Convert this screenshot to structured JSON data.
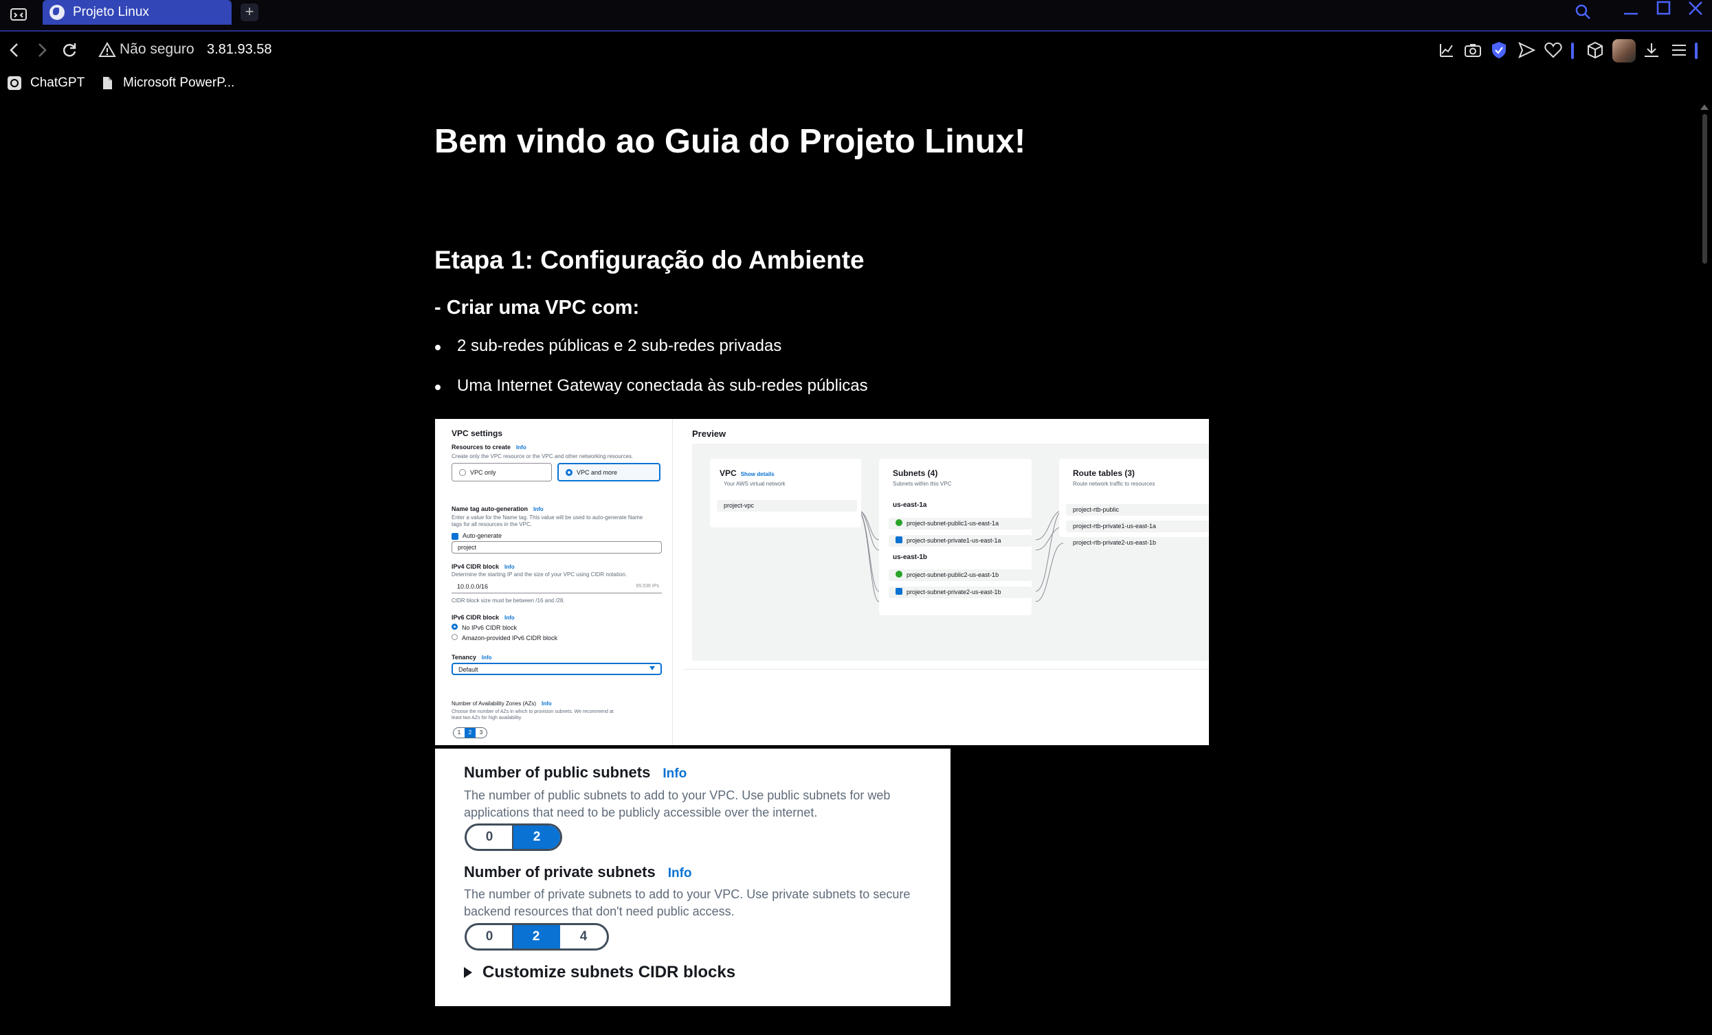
{
  "browser": {
    "tab_title": "Projeto Linux",
    "new_tab": "+",
    "security_label": "Não seguro",
    "url": "3.81.93.58",
    "bookmarks": [
      {
        "label": "ChatGPT",
        "icon": "chatgpt-icon"
      },
      {
        "label": "Microsoft PowerP...",
        "icon": "document-icon"
      }
    ],
    "accent_color": "#4b63ff",
    "tab_color": "#3246b8"
  },
  "page": {
    "title": "Bem vindo ao Guia do Projeto Linux!",
    "step_title": "Etapa 1: Configuração do Ambiente",
    "subtitle": "- Criar uma VPC com:",
    "bullets": [
      "2 sub-redes públicas e 2 sub-redes privadas",
      "Uma Internet Gateway conectada às sub-redes públicas"
    ]
  },
  "vpc_screenshot": {
    "settings": {
      "title": "VPC settings",
      "resources_label": "Resources to create",
      "info": "Info",
      "resources_desc": "Create only the VPC resource or the VPC and other networking resources.",
      "option_vpc_only": "VPC only",
      "option_vpc_and_more": "VPC and more",
      "name_tag_label": "Name tag auto-generation",
      "name_tag_desc_1": "Enter a value for the Name tag. This value will be used to auto-generate Name",
      "name_tag_desc_2": "tags for all resources in the VPC.",
      "auto_generate": "Auto-generate",
      "name_value": "project",
      "ipv4_label": "IPv4 CIDR block",
      "ipv4_desc": "Determine the starting IP and the size of your VPC using CIDR notation.",
      "ipv4_value": "10.0.0.0/16",
      "ipv4_count": "65,536 IPs",
      "ipv4_hint": "CIDR block size must be between /16 and /28.",
      "ipv6_label": "IPv6 CIDR block",
      "ipv6_opt1": "No IPv6 CIDR block",
      "ipv6_opt2": "Amazon-provided IPv6 CIDR block",
      "tenancy_label": "Tenancy",
      "tenancy_value": "Default",
      "az_label": "Number of Availability Zones (AZs)",
      "az_desc_1": "Choose the number of AZs in which to provision subnets. We recommend at",
      "az_desc_2": "least two AZs for high availability.",
      "az_options": [
        "1",
        "2",
        "3"
      ],
      "az_selected": "2"
    },
    "preview": {
      "title": "Preview",
      "vpc_title": "VPC",
      "show_details": "Show details",
      "vpc_sub": "Your AWS virtual network",
      "vpc_name": "project-vpc",
      "subnets_title": "Subnets (4)",
      "subnets_sub": "Subnets within this VPC",
      "az_a": "us-east-1a",
      "az_b": "us-east-1b",
      "subnets": [
        "project-subnet-public1-us-east-1a",
        "project-subnet-private1-us-east-1a",
        "project-subnet-public2-us-east-1b",
        "project-subnet-private2-us-east-1b"
      ],
      "rt_title": "Route tables (3)",
      "rt_sub": "Route network traffic to resources",
      "route_tables": [
        "project-rtb-public",
        "project-rtb-private1-us-east-1a",
        "project-rtb-private2-us-east-1b"
      ]
    }
  },
  "subnets_screenshot": {
    "public_label": "Number of public subnets",
    "info": "Info",
    "public_desc": "The number of public subnets to add to your VPC. Use public subnets for web applications that need to be publicly accessible over the internet.",
    "public_options": [
      "0",
      "2"
    ],
    "public_selected": "2",
    "private_label": "Number of private subnets",
    "private_desc": "The number of private subnets to add to your VPC. Use private subnets to secure backend resources that don't need public access.",
    "private_options": [
      "0",
      "2",
      "4"
    ],
    "private_selected": "2",
    "customize_label": "Customize subnets CIDR blocks",
    "selected_color": "#0972d3"
  }
}
